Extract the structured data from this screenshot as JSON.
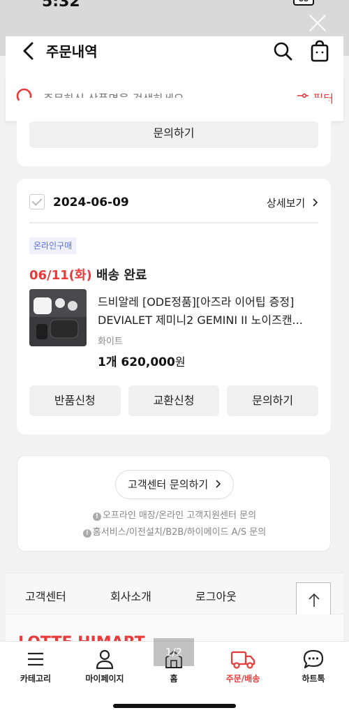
{
  "status_bar": {
    "time": "5:32",
    "battery": "88"
  },
  "header": {
    "title": "주문내역"
  },
  "search": {
    "placeholder": "주문하신 상품명을 검색하세요",
    "filter_label": "필터"
  },
  "top_card": {
    "inquiry_label": "문의하기"
  },
  "order": {
    "date": "2024-06-09",
    "detail_label": "상세보기",
    "badge": "온라인구매",
    "delivery_date": "06/11(화)",
    "delivery_status": "배송 완료",
    "product_name_line1": "드비알레 [ODE정품][아즈라 이어팁 증정]",
    "product_name_line2": "DEVIALET 제미니2 GEMINI II 노이즈캔...",
    "option": "화이트",
    "quantity_price": "1개 620,000",
    "currency": "원",
    "buttons": {
      "return": "반품신청",
      "exchange": "교환신청",
      "inquiry": "문의하기"
    }
  },
  "customer_service": {
    "button_label": "고객센터 문의하기",
    "note1": "오프라인 매장/온라인 고객지원센터 문의",
    "note2": "홈서비스/이전설치/B2B/하이메이드 A/S 문의"
  },
  "footer": {
    "links": [
      "고객센터",
      "회사소개",
      "로그아웃"
    ],
    "brand": "LOTTE HIMART"
  },
  "page_indicator": "1/2",
  "bottom_nav": [
    {
      "label": "카테고리",
      "icon": "menu-icon"
    },
    {
      "label": "마이페이지",
      "icon": "person-icon"
    },
    {
      "label": "홈",
      "icon": "home-icon"
    },
    {
      "label": "주문/배송",
      "icon": "truck-icon"
    },
    {
      "label": "하트톡",
      "icon": "chat-icon"
    }
  ],
  "colors": {
    "accent": "#e83a3a",
    "badge_text": "#5a6ee0"
  }
}
